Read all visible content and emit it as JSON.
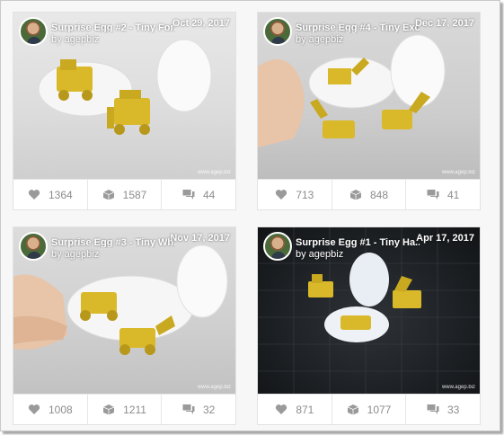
{
  "cards": [
    {
      "title": "Surprise Egg #2 - Tiny For...",
      "author": "by agepbiz",
      "date": "Oct 29, 2017",
      "watermark": "www.agep.biz",
      "likes": "1364",
      "collects": "1587",
      "comments": "44"
    },
    {
      "title": "Surprise Egg #4 - Tiny Exc...",
      "author": "by agepbiz",
      "date": "Dec 17, 2017",
      "watermark": "www.agep.biz",
      "likes": "713",
      "collects": "848",
      "comments": "41"
    },
    {
      "title": "Surprise Egg #3 - Tiny Wh...",
      "author": "by agepbiz",
      "date": "Nov 17, 2017",
      "watermark": "www.agep.biz",
      "likes": "1008",
      "collects": "1211",
      "comments": "32"
    },
    {
      "title": "Surprise Egg #1 - Tiny Ha...",
      "author": "by agepbiz",
      "date": "Apr 17, 2017",
      "watermark": "www.agep.biz",
      "likes": "871",
      "collects": "1077",
      "comments": "33"
    }
  ],
  "icons": {
    "like": "heart-icon",
    "collect": "collect-icon",
    "comment": "comment-icon"
  },
  "colors": {
    "toy_yellow": "#d9b92a",
    "egg_white": "#f4f4f4",
    "stat_text": "#8c8c8c"
  }
}
